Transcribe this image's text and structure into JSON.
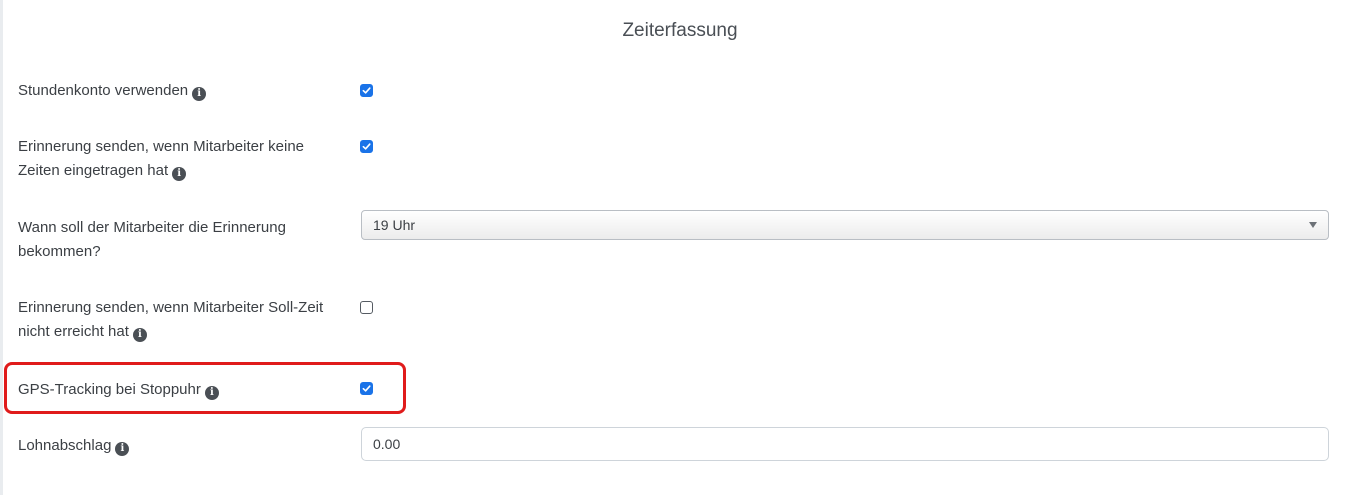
{
  "section": {
    "title": "Zeiterfassung"
  },
  "settings": {
    "stundenkonto": {
      "label": "Stundenkonto verwenden",
      "checked": true,
      "icon": "info-icon"
    },
    "erinnerung_keine_zeiten": {
      "label": "Erinnerung senden, wenn Mitarbeiter keine Zeiten eingetragen hat",
      "checked": true,
      "icon": "info-icon"
    },
    "erinnerung_zeitpunkt": {
      "label": "Wann soll der Mitarbeiter die Erinnerung bekommen?",
      "selected": "19 Uhr"
    },
    "erinnerung_soll_zeit": {
      "label": "Erinnerung senden, wenn Mitarbeiter Soll-Zeit nicht erreicht hat",
      "checked": false,
      "icon": "info-icon"
    },
    "gps_tracking": {
      "label": "GPS-Tracking bei Stoppuhr",
      "checked": true,
      "icon": "info-icon",
      "highlighted": true,
      "highlight_color": "#e01b1b"
    },
    "lohnabschlag": {
      "label": "Lohnabschlag",
      "value": "0.00",
      "icon": "info-icon"
    }
  },
  "colors": {
    "checkbox_accent": "#1a73e8",
    "text": "#3b3f44"
  }
}
